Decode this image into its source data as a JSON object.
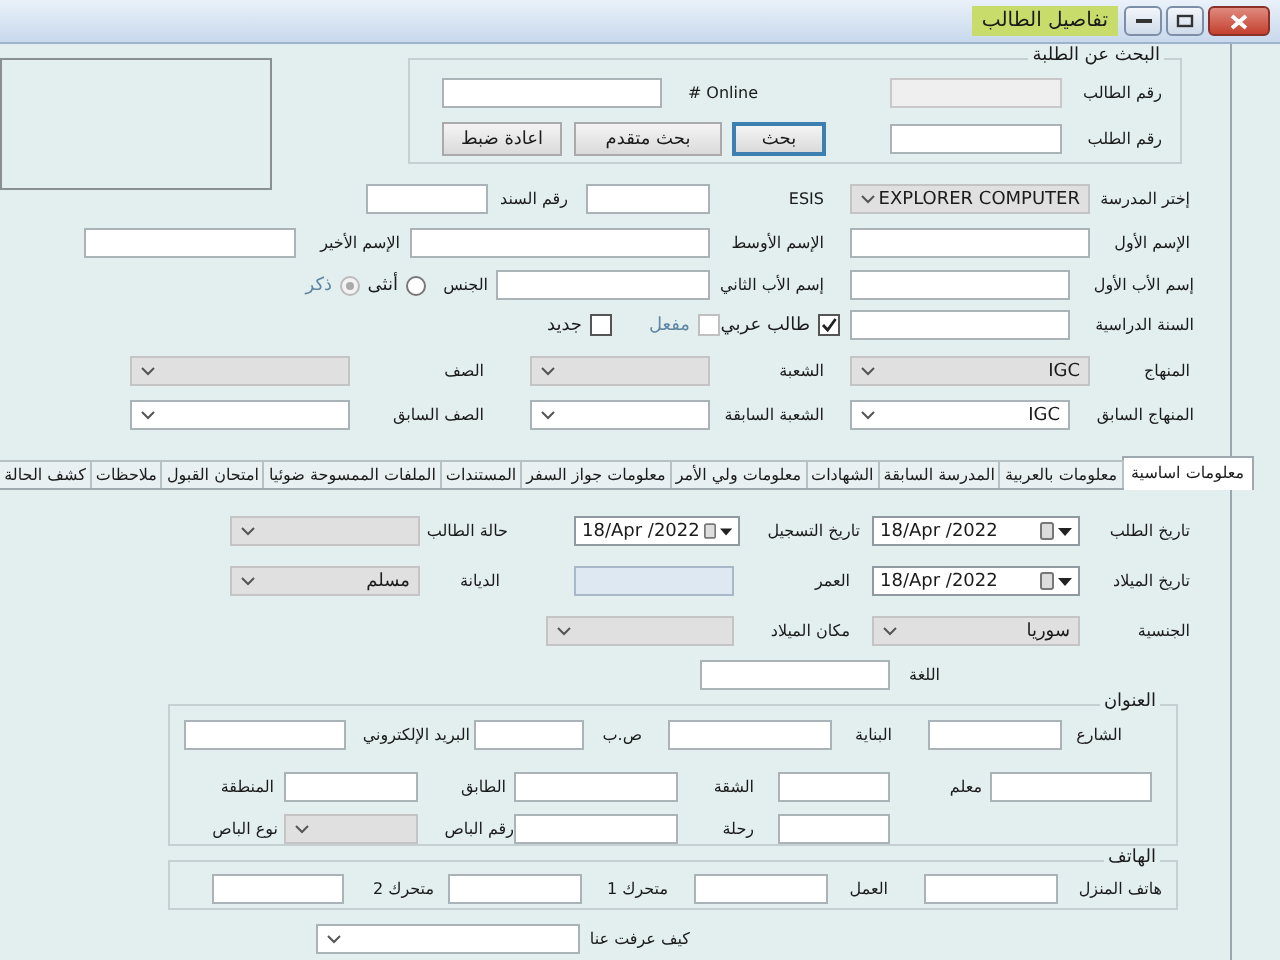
{
  "window": {
    "title": "تفاصيل الطالب"
  },
  "search": {
    "legend": "البحث عن الطلبة",
    "rows": [
      {
        "items": [
          {
            "kind": "label",
            "text": "رقم الطالب"
          },
          {
            "kind": "input",
            "disabled": true
          },
          {
            "kind": "label",
            "text": "# Online"
          },
          {
            "kind": "input",
            "disabled": false
          }
        ]
      },
      {
        "items": [
          {
            "kind": "label",
            "text": "رقم الطلب"
          },
          {
            "kind": "input",
            "disabled": false
          },
          {
            "kind": "button",
            "label": "بحث",
            "focused": true
          },
          {
            "kind": "button",
            "label": "بحث متقدم",
            "focused": false
          },
          {
            "kind": "button",
            "label": "اعادة ضبط",
            "focused": false
          }
        ]
      }
    ]
  },
  "student_form": {
    "rows": [
      {
        "items": [
          {
            "kind": "label",
            "text": "إختر المدرسة"
          },
          {
            "kind": "select",
            "value": "EXPLORER COMPUTER",
            "disabled": true
          },
          {
            "kind": "label",
            "text": "ESIS"
          },
          {
            "kind": "input",
            "disabled": false
          },
          {
            "kind": "label",
            "text": "رقم السند"
          },
          {
            "kind": "input",
            "disabled": false
          }
        ]
      },
      {
        "items": [
          {
            "kind": "label",
            "text": "الإسم الأول"
          },
          {
            "kind": "input",
            "disabled": false
          },
          {
            "kind": "label",
            "text": "الإسم الأوسط"
          },
          {
            "kind": "input",
            "disabled": false
          },
          {
            "kind": "label",
            "text": "الإسم الأخير"
          },
          {
            "kind": "input",
            "disabled": false
          }
        ]
      },
      {
        "items": [
          {
            "kind": "label",
            "text": "إسم الأب الأول"
          },
          {
            "kind": "input",
            "disabled": false
          },
          {
            "kind": "label",
            "text": "إسم الأب الثاني"
          },
          {
            "kind": "input",
            "disabled": false
          },
          {
            "kind": "label",
            "text": "الجنس"
          },
          {
            "kind": "radio",
            "label": "أنثى",
            "selected": false,
            "disabled": false
          },
          {
            "kind": "radio",
            "label": "ذكر",
            "selected": true,
            "disabled": true
          }
        ]
      },
      {
        "items": [
          {
            "kind": "label",
            "text": "السنة الدراسية"
          },
          {
            "kind": "input",
            "disabled": false
          },
          {
            "kind": "checkbox",
            "label": "طالب عربي",
            "checked": true,
            "disabled": false
          },
          {
            "kind": "checkbox",
            "label": "مفعل",
            "checked": false,
            "disabled": true
          },
          {
            "kind": "checkbox",
            "label": "جديد",
            "checked": false,
            "disabled": false
          }
        ]
      },
      {
        "items": [
          {
            "kind": "label",
            "text": "المنهاج"
          },
          {
            "kind": "select",
            "value": "IGC",
            "disabled": true
          },
          {
            "kind": "label",
            "text": "الشعبة"
          },
          {
            "kind": "select",
            "disabled": true
          },
          {
            "kind": "label",
            "text": "الصف"
          },
          {
            "kind": "select",
            "disabled": true
          }
        ]
      },
      {
        "items": [
          {
            "kind": "label",
            "text": "المنهاج السابق"
          },
          {
            "kind": "select",
            "value": "IGC",
            "disabled": false
          },
          {
            "kind": "label",
            "text": "الشعبة السابقة"
          },
          {
            "kind": "select",
            "disabled": false
          },
          {
            "kind": "label",
            "text": "الصف السابق"
          },
          {
            "kind": "select",
            "disabled": false
          }
        ]
      }
    ]
  },
  "tabs": [
    {
      "label": "معلومات اساسية",
      "selected": true
    },
    {
      "label": "معلومات بالعربية",
      "selected": false
    },
    {
      "label": "المدرسة السابقة",
      "selected": false
    },
    {
      "label": "الشهادات",
      "selected": false
    },
    {
      "label": "معلومات ولي الأمر",
      "selected": false
    },
    {
      "label": "معلومات جواز السفر",
      "selected": false
    },
    {
      "label": "المستندات",
      "selected": false
    },
    {
      "label": "الملفات الممسوحة ضوئيا",
      "selected": false
    },
    {
      "label": "امتحان القبول",
      "selected": false
    },
    {
      "label": "ملاحظات",
      "selected": false
    },
    {
      "label": "كشف الحالة",
      "selected": false
    }
  ],
  "basic_info": {
    "rows": [
      {
        "items": [
          {
            "kind": "label",
            "text": "تاريخ الطلب"
          },
          {
            "kind": "date",
            "value": "18/Apr /2022"
          },
          {
            "kind": "label",
            "text": "تاريخ التسجيل"
          },
          {
            "kind": "date",
            "value": "18/Apr /2022"
          },
          {
            "kind": "label",
            "text": "حالة الطالب"
          },
          {
            "kind": "select",
            "disabled": true
          }
        ]
      },
      {
        "items": [
          {
            "kind": "label",
            "text": "تاريخ الميلاد"
          },
          {
            "kind": "date",
            "value": "18/Apr /2022"
          },
          {
            "kind": "label",
            "text": "العمر"
          },
          {
            "kind": "output"
          },
          {
            "kind": "label",
            "text": "الديانة"
          },
          {
            "kind": "select",
            "value": "مسلم",
            "disabled": true
          }
        ]
      },
      {
        "items": [
          {
            "kind": "label",
            "text": "الجنسية"
          },
          {
            "kind": "select",
            "value": "سوريا",
            "disabled": true
          },
          {
            "kind": "label",
            "text": "مكان الميلاد"
          },
          {
            "kind": "select",
            "disabled": true
          }
        ]
      },
      {
        "items": [
          {
            "kind": "label",
            "text": "اللغة"
          },
          {
            "kind": "input",
            "disabled": false
          }
        ]
      }
    ]
  },
  "address": {
    "legend": "العنوان",
    "rows": [
      {
        "items": [
          {
            "kind": "label",
            "text": "الشارع"
          },
          {
            "kind": "input",
            "disabled": false
          },
          {
            "kind": "label",
            "text": "البناية"
          },
          {
            "kind": "input",
            "disabled": false
          },
          {
            "kind": "label",
            "text": "ص.ب"
          },
          {
            "kind": "input",
            "disabled": false
          },
          {
            "kind": "label",
            "text": "البريد الإلكتروني"
          },
          {
            "kind": "input",
            "disabled": false
          }
        ]
      },
      {
        "items": [
          {
            "kind": "input",
            "disabled": false
          },
          {
            "kind": "label",
            "text": "معلم"
          },
          {
            "kind": "input",
            "disabled": false
          },
          {
            "kind": "label",
            "text": "الشقة"
          },
          {
            "kind": "input",
            "disabled": false
          },
          {
            "kind": "label",
            "text": "الطابق"
          },
          {
            "kind": "input",
            "disabled": false
          },
          {
            "kind": "label",
            "text": "المنطقة"
          }
        ]
      },
      {
        "items": [
          {
            "kind": "input",
            "disabled": false
          },
          {
            "kind": "label",
            "text": "رحلة"
          },
          {
            "kind": "input",
            "disabled": false
          },
          {
            "kind": "label",
            "text": "رقم الباص"
          },
          {
            "kind": "select",
            "disabled": true
          },
          {
            "kind": "label",
            "text": "نوع الباص"
          }
        ]
      }
    ]
  },
  "phone": {
    "legend": "الهاتف",
    "rows": [
      {
        "items": [
          {
            "kind": "label",
            "text": "هاتف المنزل"
          },
          {
            "kind": "input",
            "disabled": false
          },
          {
            "kind": "label",
            "text": "العمل"
          },
          {
            "kind": "input",
            "disabled": false
          },
          {
            "kind": "label",
            "text": "متحرك 1"
          },
          {
            "kind": "input",
            "disabled": false
          },
          {
            "kind": "label",
            "text": "متحرك 2"
          },
          {
            "kind": "input",
            "disabled": false
          }
        ]
      }
    ]
  },
  "referral": {
    "rows": [
      {
        "items": [
          {
            "kind": "label",
            "text": "كيف عرفت عنا"
          },
          {
            "kind": "select",
            "disabled": false
          }
        ]
      }
    ]
  }
}
